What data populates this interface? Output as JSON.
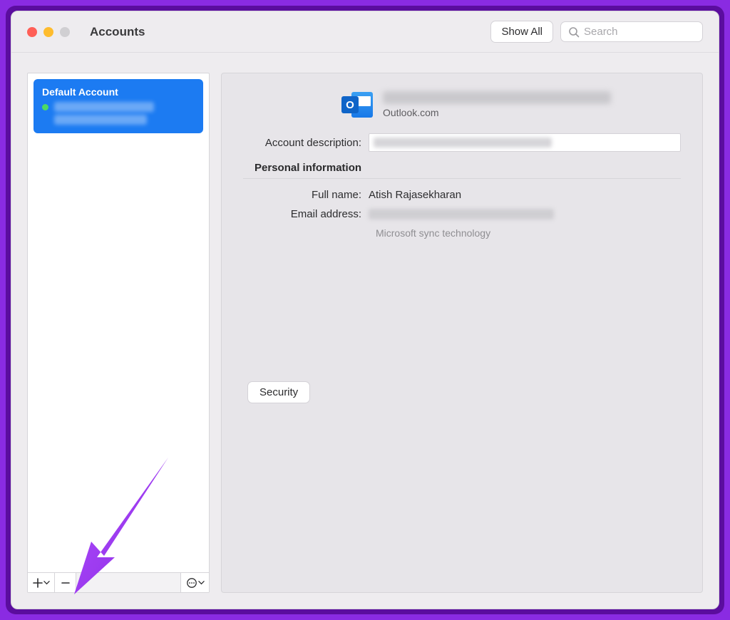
{
  "window": {
    "title": "Accounts",
    "show_all_label": "Show All",
    "search_placeholder": "Search"
  },
  "sidebar": {
    "accounts": [
      {
        "title": "Default Account",
        "online": true
      }
    ]
  },
  "main": {
    "service_name": "Outlook.com",
    "icon_letter": "O",
    "labels": {
      "account_description": "Account description:",
      "personal_info": "Personal information",
      "full_name": "Full name:",
      "email_address": "Email address:"
    },
    "values": {
      "full_name": "Atish Rajasekharan",
      "sync_tech": "Microsoft sync technology"
    },
    "security_label": "Security"
  }
}
